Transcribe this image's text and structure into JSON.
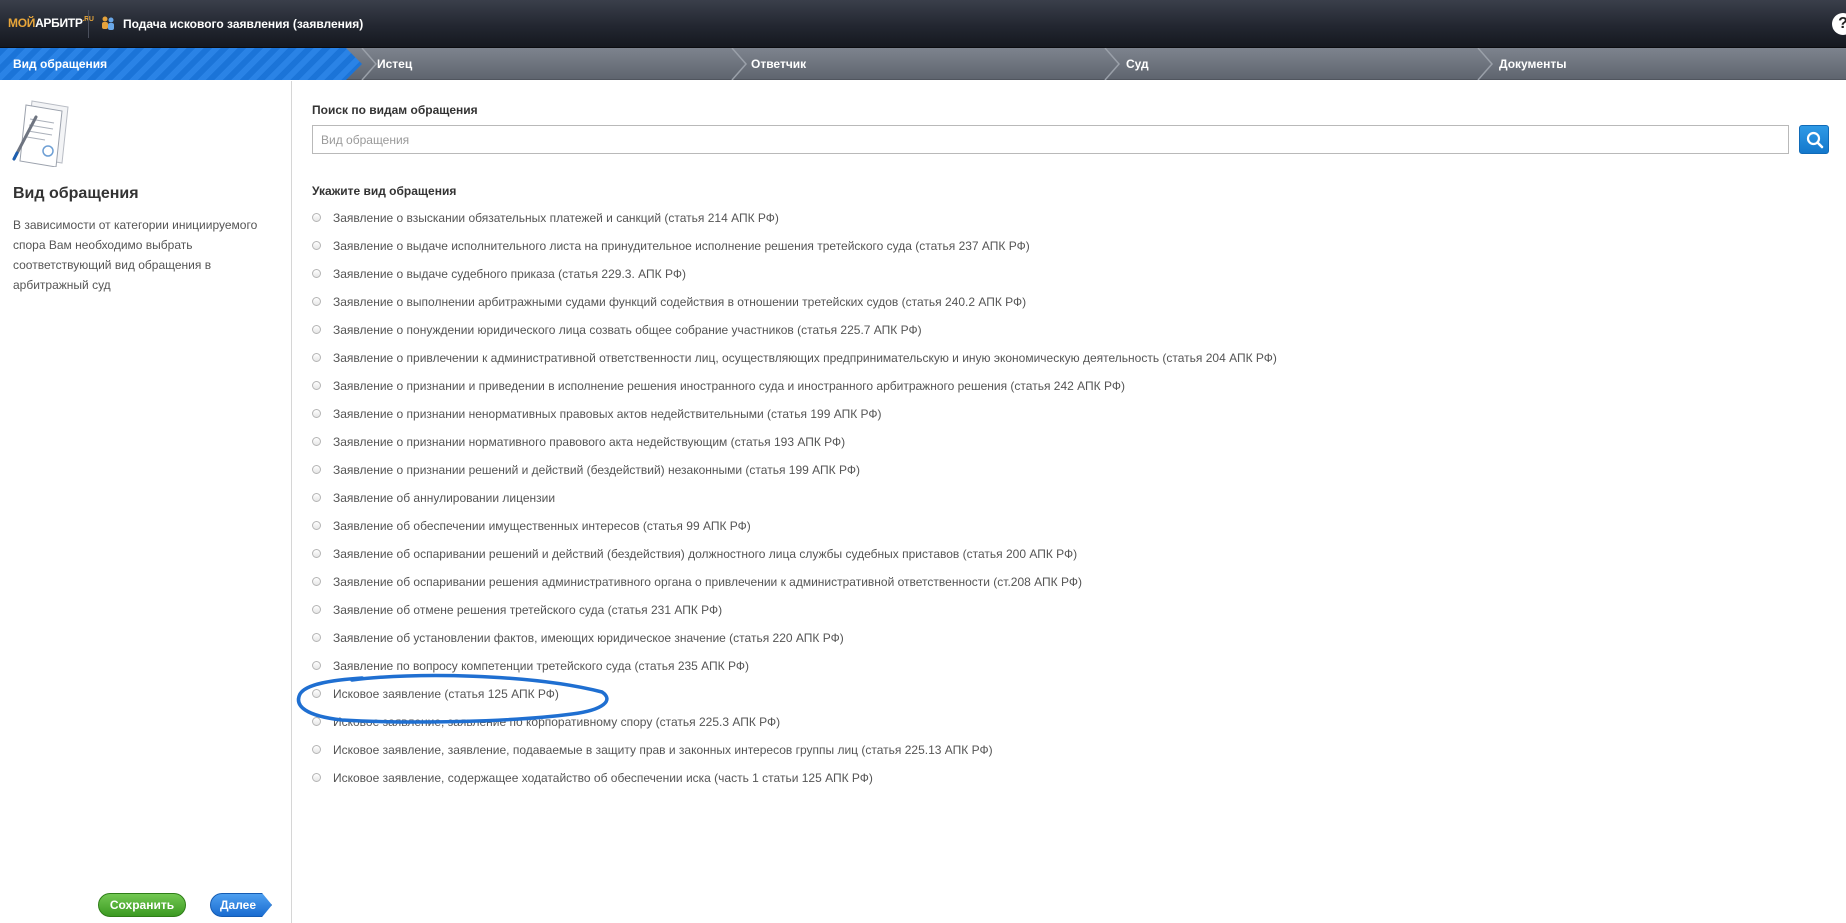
{
  "header": {
    "logo": {
      "part1": "МОЙ",
      "part2": "АРБИТР",
      "part3": ".RU"
    },
    "app_icon": "people-icon",
    "title": "Подача искового заявления (заявления)",
    "help": "?"
  },
  "steps": [
    {
      "label": "Вид обращения",
      "active": true
    },
    {
      "label": "Истец",
      "active": false
    },
    {
      "label": "Ответчик",
      "active": false
    },
    {
      "label": "Суд",
      "active": false
    },
    {
      "label": "Документы",
      "active": false
    }
  ],
  "sidebar": {
    "icon": "document-icon",
    "title": "Вид обращения",
    "description": "В зависимости от категории инициируемого спора Вам необходимо выбрать соответствующий вид обращения в арбитражный суд",
    "save_label": "Сохранить",
    "next_label": "Далее"
  },
  "search": {
    "label": "Поиск по видам обращения",
    "placeholder": "Вид обращения",
    "value": "",
    "button_icon": "search-icon"
  },
  "options_title": "Укажите вид обращения",
  "options": [
    "Заявление о взыскании обязательных платежей и санкций (статья 214 АПК РФ)",
    "Заявление о выдаче исполнительного листа на принудительное исполнение решения третейского суда (статья 237 АПК РФ)",
    "Заявление о выдаче судебного приказа (статья 229.3. АПК РФ)",
    "Заявление о выполнении арбитражными судами функций содействия в отношении третейских судов (статья 240.2 АПК РФ)",
    "Заявление о понуждении юридического лица созвать общее собрание участников (статья 225.7 АПК РФ)",
    "Заявление о привлечении к административной ответственности лиц, осуществляющих предпринимательскую и иную экономическую деятельность (статья 204 АПК РФ)",
    "Заявление о признании и приведении в исполнение решения иностранного суда и иностранного арбитражного решения (статья 242 АПК РФ)",
    "Заявление о признании ненормативных правовых актов недействительными (статья 199 АПК РФ)",
    "Заявление о признании нормативного правового акта недействующим (статья 193 АПК РФ)",
    "Заявление о признании решений и действий (бездействий) незаконными (статья 199 АПК РФ)",
    "Заявление об аннулировании лицензии",
    "Заявление об обеспечении имущественных интересов (статья 99 АПК РФ)",
    "Заявление об оспаривании решений и действий (бездействия) должностного лица службы судебных приставов (статья 200 АПК РФ)",
    "Заявление об оспаривании решения административного органа о привлечении к административной ответственности (ст.208 АПК РФ)",
    "Заявление об отмене решения третейского суда (статья 231 АПК РФ)",
    "Заявление об установлении фактов, имеющих юридическое значение (статья 220 АПК РФ)",
    "Заявление по вопросу компетенции третейского суда (статья 235 АПК РФ)",
    "Исковое заявление (статья 125 АПК РФ)",
    "Исковое заявление, заявление по корпоративному спору (статья 225.3 АПК РФ)",
    "Исковое заявление, заявление, подаваемые в защиту прав и законных интересов группы лиц (статья 225.13 АПК РФ)",
    "Исковое заявление, содержащее ходатайство об обеспечении иска (часть 1 статьи 125 АПК РФ)"
  ],
  "highlighted_option": "Исковое заявление (статья 125 АПК РФ)",
  "colors": {
    "active_step": "#1b74d8",
    "annotation": "#1f6fd1",
    "save_button": "#3c9a22",
    "next_button": "#1a6cd0"
  }
}
